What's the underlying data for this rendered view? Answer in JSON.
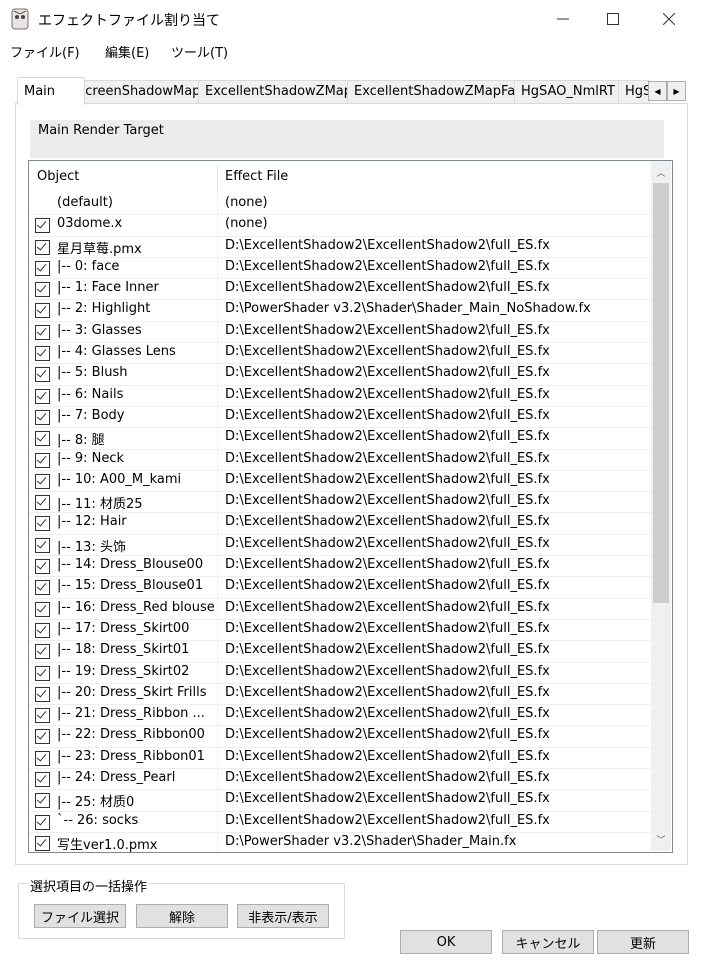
{
  "window": {
    "title": "エフェクトファイル割り当て"
  },
  "menu": [
    "ファイル(F)",
    "編集(E)",
    "ツール(T)"
  ],
  "tabs": [
    "Main",
    "ScreenShadowMap",
    "ExcellentShadowZMap",
    "ExcellentShadowZMapFar",
    "HgSAO_NmlRT",
    "HgS"
  ],
  "render_target_label": "Main Render Target",
  "columns": {
    "object": "Object",
    "effect": "Effect File"
  },
  "rows": [
    {
      "checked": false,
      "object": "(default)",
      "effect": "(none)"
    },
    {
      "checked": true,
      "object": "03dome.x",
      "effect": "(none)"
    },
    {
      "checked": true,
      "object": "星月草莓.pmx",
      "effect": "D:\\ExcellentShadow2\\ExcellentShadow2\\full_ES.fx"
    },
    {
      "checked": true,
      "object": " |-- 0: face",
      "effect": "D:\\ExcellentShadow2\\ExcellentShadow2\\full_ES.fx"
    },
    {
      "checked": true,
      "object": " |-- 1: Face Inner",
      "effect": "D:\\ExcellentShadow2\\ExcellentShadow2\\full_ES.fx"
    },
    {
      "checked": true,
      "object": " |-- 2: Highlight",
      "effect": "D:\\PowerShader v3.2\\Shader\\Shader_Main_NoShadow.fx"
    },
    {
      "checked": true,
      "object": " |-- 3: Glasses",
      "effect": "D:\\ExcellentShadow2\\ExcellentShadow2\\full_ES.fx"
    },
    {
      "checked": true,
      "object": " |-- 4: Glasses Lens",
      "effect": "D:\\ExcellentShadow2\\ExcellentShadow2\\full_ES.fx"
    },
    {
      "checked": true,
      "object": " |-- 5: Blush",
      "effect": "D:\\ExcellentShadow2\\ExcellentShadow2\\full_ES.fx"
    },
    {
      "checked": true,
      "object": " |-- 6: Nails",
      "effect": "D:\\ExcellentShadow2\\ExcellentShadow2\\full_ES.fx"
    },
    {
      "checked": true,
      "object": " |-- 7: Body",
      "effect": "D:\\ExcellentShadow2\\ExcellentShadow2\\full_ES.fx"
    },
    {
      "checked": true,
      "object": " |-- 8: 腿",
      "effect": "D:\\ExcellentShadow2\\ExcellentShadow2\\full_ES.fx"
    },
    {
      "checked": true,
      "object": " |-- 9: Neck",
      "effect": "D:\\ExcellentShadow2\\ExcellentShadow2\\full_ES.fx"
    },
    {
      "checked": true,
      "object": " |-- 10: A00_M_kami",
      "effect": "D:\\ExcellentShadow2\\ExcellentShadow2\\full_ES.fx"
    },
    {
      "checked": true,
      "object": " |-- 11: 材质25",
      "effect": "D:\\ExcellentShadow2\\ExcellentShadow2\\full_ES.fx"
    },
    {
      "checked": true,
      "object": " |-- 12: Hair",
      "effect": "D:\\ExcellentShadow2\\ExcellentShadow2\\full_ES.fx"
    },
    {
      "checked": true,
      "object": " |-- 13: 头饰",
      "effect": "D:\\ExcellentShadow2\\ExcellentShadow2\\full_ES.fx"
    },
    {
      "checked": true,
      "object": " |-- 14: Dress_Blouse00",
      "effect": "D:\\ExcellentShadow2\\ExcellentShadow2\\full_ES.fx"
    },
    {
      "checked": true,
      "object": " |-- 15: Dress_Blouse01",
      "effect": "D:\\ExcellentShadow2\\ExcellentShadow2\\full_ES.fx"
    },
    {
      "checked": true,
      "object": " |-- 16: Dress_Red blouse",
      "effect": "D:\\ExcellentShadow2\\ExcellentShadow2\\full_ES.fx"
    },
    {
      "checked": true,
      "object": " |-- 17: Dress_Skirt00",
      "effect": "D:\\ExcellentShadow2\\ExcellentShadow2\\full_ES.fx"
    },
    {
      "checked": true,
      "object": " |-- 18: Dress_Skirt01",
      "effect": "D:\\ExcellentShadow2\\ExcellentShadow2\\full_ES.fx"
    },
    {
      "checked": true,
      "object": " |-- 19: Dress_Skirt02",
      "effect": "D:\\ExcellentShadow2\\ExcellentShadow2\\full_ES.fx"
    },
    {
      "checked": true,
      "object": " |-- 20: Dress_Skirt Frills",
      "effect": "D:\\ExcellentShadow2\\ExcellentShadow2\\full_ES.fx"
    },
    {
      "checked": true,
      "object": " |-- 21: Dress_Ribbon ...",
      "effect": "D:\\ExcellentShadow2\\ExcellentShadow2\\full_ES.fx"
    },
    {
      "checked": true,
      "object": " |-- 22: Dress_Ribbon00",
      "effect": "D:\\ExcellentShadow2\\ExcellentShadow2\\full_ES.fx"
    },
    {
      "checked": true,
      "object": " |-- 23: Dress_Ribbon01",
      "effect": "D:\\ExcellentShadow2\\ExcellentShadow2\\full_ES.fx"
    },
    {
      "checked": true,
      "object": " |-- 24: Dress_Pearl",
      "effect": "D:\\ExcellentShadow2\\ExcellentShadow2\\full_ES.fx"
    },
    {
      "checked": true,
      "object": " |-- 25: 材质0",
      "effect": "D:\\ExcellentShadow2\\ExcellentShadow2\\full_ES.fx"
    },
    {
      "checked": true,
      "object": " `-- 26: socks",
      "effect": "D:\\ExcellentShadow2\\ExcellentShadow2\\full_ES.fx"
    },
    {
      "checked": true,
      "object": "写生ver1.0.pmx",
      "effect": "D:\\PowerShader v3.2\\Shader\\Shader_Main.fx"
    }
  ],
  "bulk": {
    "label": "選択項目の一括操作",
    "select_file": "ファイル選択",
    "release": "解除",
    "toggle_visibility": "非表示/表示"
  },
  "dialog": {
    "ok": "OK",
    "cancel": "キャンセル",
    "update": "更新"
  }
}
